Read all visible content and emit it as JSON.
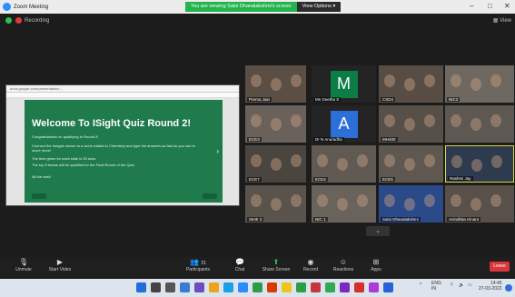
{
  "window": {
    "title": "Zoom Meeting"
  },
  "banner": {
    "message": "You are viewing Saloi Dhanalakshmi's screen",
    "view_options": "View Options"
  },
  "meeting": {
    "recording_label": "Recording",
    "view_label": "View"
  },
  "share": {
    "url": "docs.google.com/presentation/...",
    "slide_title": "Welcome To ISight Quiz Round 2!",
    "lines": [
      "Congratulations on qualifying to Round 2!",
      "Connect the Images shown to a word related to Chemistry and type the answers as fast as you can to score more!",
      "The time given for each slide is 35 secs.",
      "The top 5 teams will be qualified for the Final Round of the Quiz.",
      "All the best!"
    ]
  },
  "participants": [
    {
      "name": "Prerna Jain",
      "color": "#5a4e45"
    },
    {
      "name": "",
      "color": "#6e6a64"
    },
    {
      "name": "Ms Geetha S",
      "avatar_letter": "M",
      "color": "#0d7d48"
    },
    {
      "name": "",
      "color": "#4e4a44"
    },
    {
      "name": "CSD4",
      "color": "#584d44"
    },
    {
      "name": "NIC2",
      "color": "#6e6860"
    },
    {
      "name": "",
      "color": "#5c5a58"
    },
    {
      "name": "ECE3",
      "color": "#6a625a"
    },
    {
      "name": "Dr N Anuradha",
      "avatar_letter": "A",
      "color": "#2d6fd8"
    },
    {
      "name": "",
      "color": "#5d554e"
    },
    {
      "name": "MH400",
      "color": "#565049"
    },
    {
      "name": "",
      "color": "#5e5852"
    },
    {
      "name": "ECE7",
      "color": "#4b4540"
    },
    {
      "name": "",
      "color": "#6b5a4f"
    },
    {
      "name": "ECE4",
      "color": "#615a53"
    },
    {
      "name": "ECE5",
      "color": "#5f5851"
    },
    {
      "name": "Rashmi Jay",
      "color": "#2e3a4e"
    },
    {
      "name": "SIHE 3",
      "color": "#5a534c"
    },
    {
      "name": "NIC 1",
      "color": "#6a635b"
    },
    {
      "name": "",
      "color": "#5d5650"
    },
    {
      "name": "Saloi Dhanalakshmi",
      "color": "#2b4a8a"
    },
    {
      "name": "Anindhita Hinant",
      "color": "#585049"
    }
  ],
  "toolbar": {
    "unmute": "Unmute",
    "start_video": "Start Video",
    "participants": "Participants",
    "participants_count": "21",
    "chat": "Chat",
    "share_screen": "Share Screen",
    "record": "Record",
    "reactions": "Reactions",
    "apps": "Apps",
    "leave": "Leave"
  },
  "tray": {
    "lang": "ENG",
    "region": "IN",
    "time": "14:45",
    "date": "27-03-2022"
  }
}
